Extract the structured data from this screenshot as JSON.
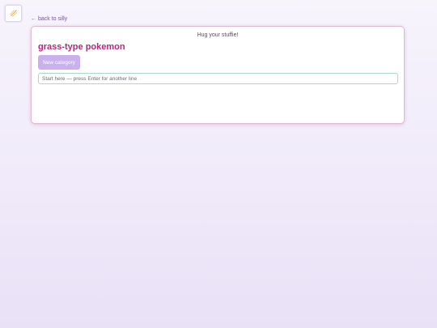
{
  "app": {
    "icon_name": "sparkle-icon"
  },
  "nav": {
    "back_label": "← back to silly"
  },
  "card": {
    "tagline": "Hug your stuffie!",
    "title": "grass-type pokemon",
    "new_category_label": "New category",
    "input": {
      "value": "",
      "placeholder": "Start here — press Enter for another line"
    }
  },
  "colors": {
    "title": "#b3287a",
    "button_bg": "#cbb0ef",
    "link": "#7a4fb0",
    "input_border": "#a9d9c9",
    "card_border": "#e2b7d2"
  }
}
